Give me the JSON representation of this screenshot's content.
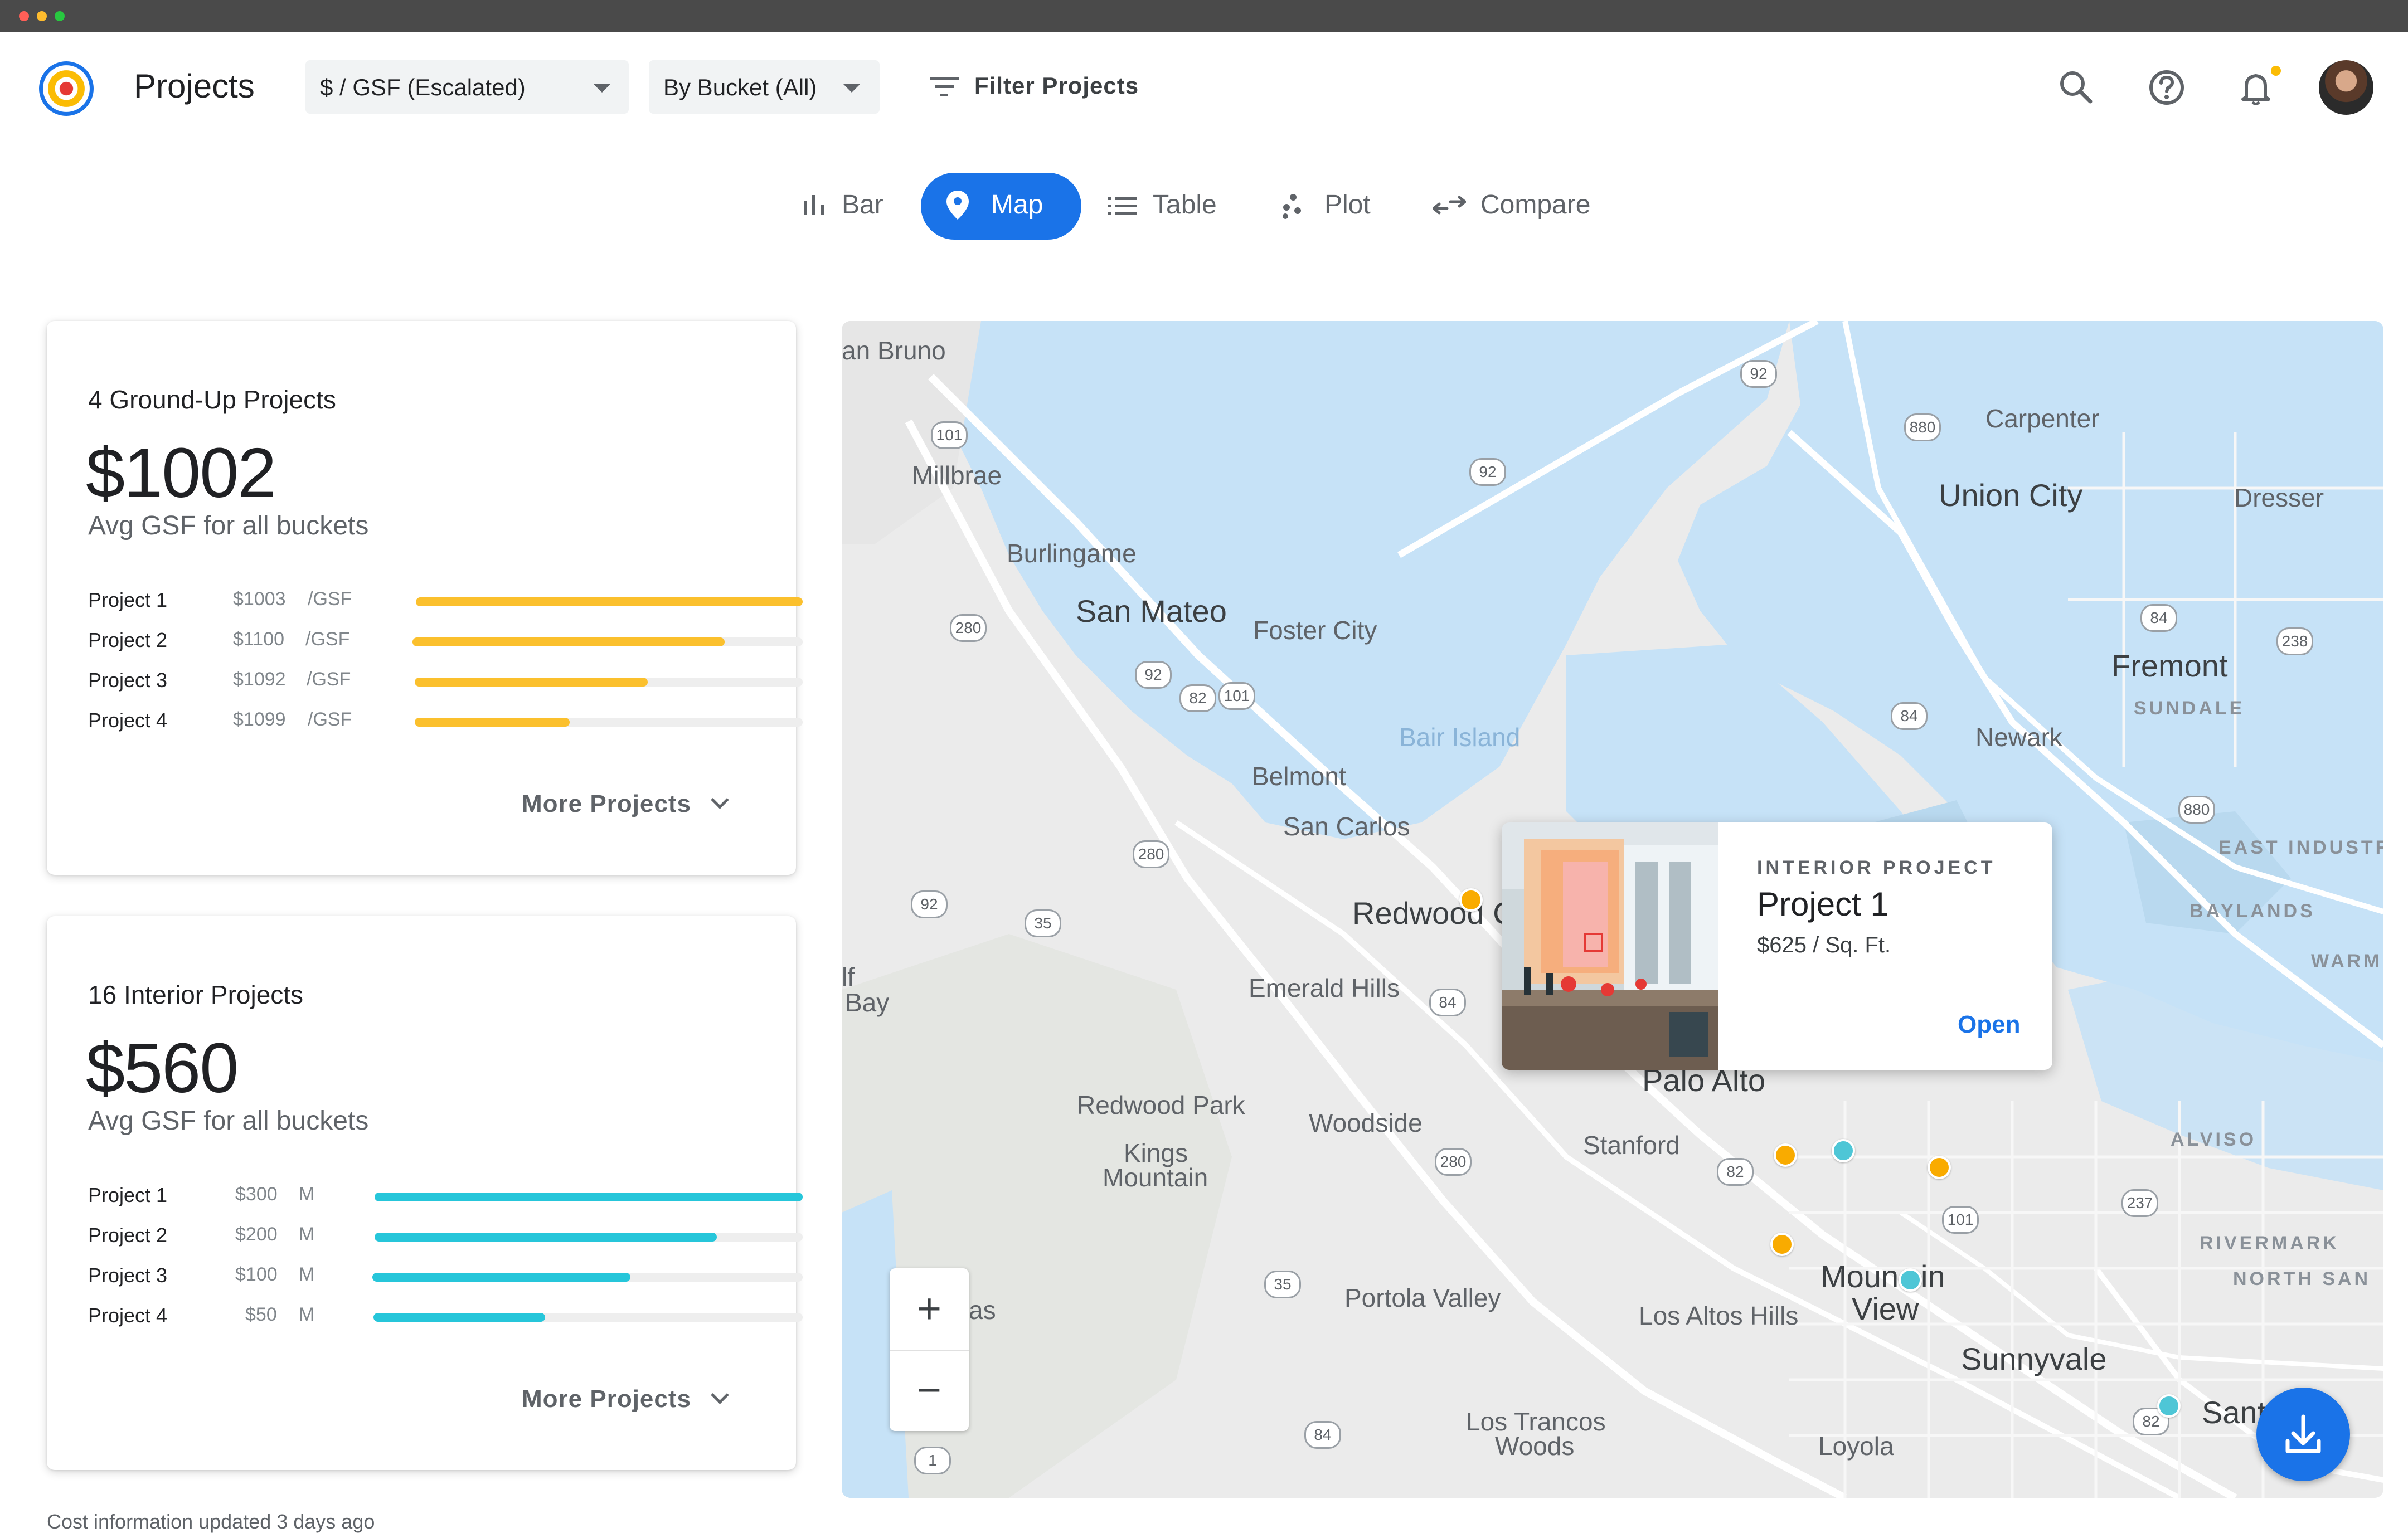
{
  "header": {
    "app_title": "Projects",
    "metric_dropdown": "$ / GSF (Escalated)",
    "bucket_dropdown": "By Bucket (All)",
    "filter_label": "Filter Projects",
    "icons": [
      "search-icon",
      "help-icon",
      "notifications-icon",
      "avatar"
    ],
    "notification_dot_color": "#fbbc04"
  },
  "view_tabs": [
    {
      "label": "Bar",
      "icon": "bar-chart-icon",
      "active": false
    },
    {
      "label": "Map",
      "icon": "map-pin-icon",
      "active": true
    },
    {
      "label": "Table",
      "icon": "list-icon",
      "active": false
    },
    {
      "label": "Plot",
      "icon": "scatter-icon",
      "active": false
    },
    {
      "label": "Compare",
      "icon": "compare-arrows-icon",
      "active": false
    }
  ],
  "ground_up": {
    "title": "4 Ground-Up Projects",
    "value": "$1002",
    "subtitle": "Avg GSF for all buckets",
    "bar_color": "#fbc02d",
    "projects": [
      {
        "name": "Project 1",
        "value": "$1003",
        "unit": "/GSF",
        "fill_pct": 100
      },
      {
        "name": "Project 2",
        "value": "$1100",
        "unit": "/GSF",
        "fill_pct": 80
      },
      {
        "name": "Project 3",
        "value": "$1092",
        "unit": "/GSF",
        "fill_pct": 60
      },
      {
        "name": "Project 4",
        "value": "$1099",
        "unit": "/GSF",
        "fill_pct": 40
      }
    ],
    "more_label": "More Projects"
  },
  "interior": {
    "title": "16 Interior Projects",
    "value": "$560",
    "subtitle": "Avg GSF for all buckets",
    "bar_color": "#26c6da",
    "projects": [
      {
        "name": "Project 1",
        "value": "$300",
        "unit": "M",
        "fill_pct": 100
      },
      {
        "name": "Project 2",
        "value": "$200",
        "unit": "M",
        "fill_pct": 80
      },
      {
        "name": "Project 3",
        "value": "$100",
        "unit": "M",
        "fill_pct": 60
      },
      {
        "name": "Project 4",
        "value": "$50",
        "unit": "M",
        "fill_pct": 40
      }
    ],
    "more_label": "More Projects"
  },
  "footer_note": "Cost information updated 3 days ago",
  "map": {
    "places": [
      "an Bruno",
      "Millbrae",
      "Carpenter",
      "Union City",
      "Dresser",
      "Burlingame",
      "San Mateo",
      "Foster City",
      "Fremont",
      "SUNDALE",
      "Newark",
      "Bair Island",
      "Belmont",
      "San Carlos",
      "EAST INDUSTRI",
      "BAYLANDS",
      "Redwood C",
      "WARM",
      "lf",
      "Bay",
      "Emerald Hills",
      "Palo Alto",
      "ALVISO",
      "Redwood Park",
      "Kings",
      "Mountain",
      "Woodside",
      "Stanford",
      "RIVERMARK",
      "NORTH SAN",
      "Moun",
      "in",
      "View",
      "as",
      "Portola Valley",
      "Los Altos Hills",
      "Sunnyvale",
      "Los Trancos",
      "Woods",
      "Loyola",
      "Santa"
    ],
    "shields": [
      "92",
      "101",
      "880",
      "92",
      "280",
      "84",
      "238",
      "92",
      "82",
      "101",
      "84",
      "880",
      "280",
      "92",
      "35",
      "84",
      "82",
      "101",
      "280",
      "237",
      "35",
      "84",
      "82",
      "1"
    ],
    "zoom_in": "+",
    "zoom_out": "−",
    "pin_colors": {
      "ground_up": "#f9ab00",
      "interior": "#4ec6d6"
    },
    "popup": {
      "kicker": "INTERIOR PROJECT",
      "name": "Project 1",
      "price": "$625 / Sq. Ft.",
      "open_label": "Open"
    }
  },
  "colors": {
    "accent": "#1a73e8",
    "water": "#c6e2f7",
    "land": "#ebebeb"
  }
}
